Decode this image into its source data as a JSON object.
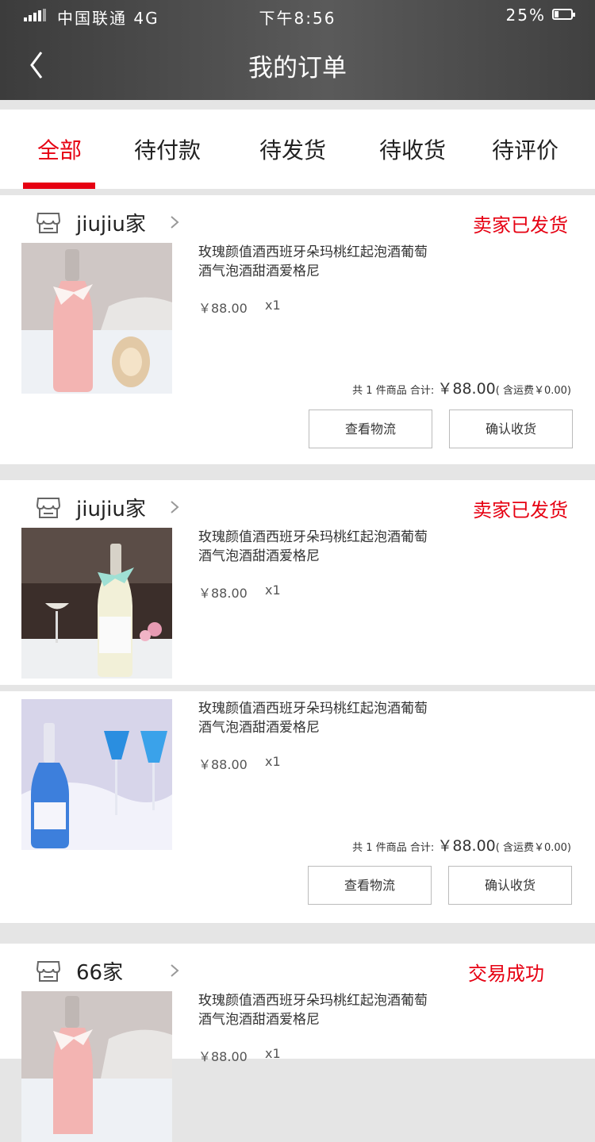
{
  "status_bar": {
    "carrier": "中国联通 4G",
    "time": "下午8:56",
    "battery": "25%",
    "battery_level": 0.25
  },
  "nav": {
    "title": "我的订单"
  },
  "tabs": [
    {
      "label": "全部",
      "active": true
    },
    {
      "label": "待付款",
      "active": false
    },
    {
      "label": "待发货",
      "active": false
    },
    {
      "label": "待收货",
      "active": false
    },
    {
      "label": "待评价",
      "active": false
    }
  ],
  "orders": [
    {
      "shop": "jiujiu家",
      "status": "卖家已发货",
      "items": [
        {
          "name": "玫瑰颜值酒西班牙朵玛桃红起泡酒葡萄酒气泡酒甜酒爱格尼",
          "price": "￥88.00",
          "qty": "x1",
          "image": "pink-wine-bottle"
        }
      ],
      "summary": {
        "count_text": "共 1 件商品 合计:",
        "total": "￥88.00",
        "shipping": "( 含运费￥0.00)"
      },
      "buttons": [
        "查看物流",
        "确认收货"
      ]
    },
    {
      "shop": "jiujiu家",
      "status": "卖家已发货",
      "items": [
        {
          "name": "玫瑰颜值酒西班牙朵玛桃红起泡酒葡萄酒气泡酒甜酒爱格尼",
          "price": "￥88.00",
          "qty": "x1",
          "image": "white-wine-bottle"
        },
        {
          "name": "玫瑰颜值酒西班牙朵玛桃红起泡酒葡萄酒气泡酒甜酒爱格尼",
          "price": "￥88.00",
          "qty": "x1",
          "image": "blue-wine-bottle"
        }
      ],
      "summary": {
        "count_text": "共 1 件商品 合计:",
        "total": "￥88.00",
        "shipping": "( 含运费￥0.00)"
      },
      "buttons": [
        "查看物流",
        "确认收货"
      ]
    },
    {
      "shop": "66家",
      "status": "交易成功",
      "items": [
        {
          "name": "玫瑰颜值酒西班牙朵玛桃红起泡酒葡萄酒气泡酒甜酒爱格尼",
          "price": "￥88.00",
          "qty": "x1",
          "image": "pink-wine-bottle"
        }
      ]
    }
  ]
}
